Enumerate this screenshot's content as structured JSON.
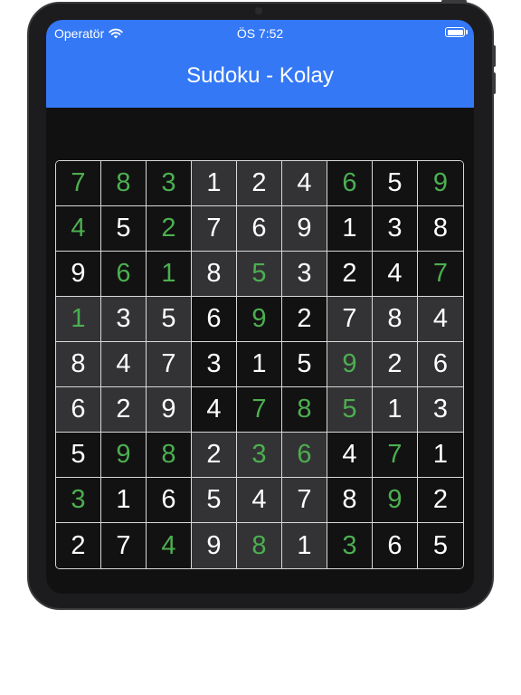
{
  "status_bar": {
    "carrier": "Operatör",
    "time": "ÖS 7:52",
    "wifi_icon": "wifi-icon",
    "battery_icon": "battery-icon"
  },
  "navbar": {
    "title": "Sudoku - Kolay"
  },
  "colors": {
    "accent": "#3478f6",
    "given_digit": "#ffffff",
    "entered_digit": "#4caf50",
    "box_dark": "#121212",
    "box_light": "#333335",
    "grid_line": "#d8d8d8"
  },
  "board": {
    "rows": [
      [
        "7",
        "8",
        "3",
        "1",
        "2",
        "4",
        "6",
        "5",
        "9"
      ],
      [
        "4",
        "5",
        "2",
        "7",
        "6",
        "9",
        "1",
        "3",
        "8"
      ],
      [
        "9",
        "6",
        "1",
        "8",
        "5",
        "3",
        "2",
        "4",
        "7"
      ],
      [
        "1",
        "3",
        "5",
        "6",
        "9",
        "2",
        "7",
        "8",
        "4"
      ],
      [
        "8",
        "4",
        "7",
        "3",
        "1",
        "5",
        "9",
        "2",
        "6"
      ],
      [
        "6",
        "2",
        "9",
        "4",
        "7",
        "8",
        "5",
        "1",
        "3"
      ],
      [
        "5",
        "9",
        "8",
        "2",
        "3",
        "6",
        "4",
        "7",
        "1"
      ],
      [
        "3",
        "1",
        "6",
        "5",
        "4",
        "7",
        "8",
        "9",
        "2"
      ],
      [
        "2",
        "7",
        "4",
        "9",
        "8",
        "1",
        "3",
        "6",
        "5"
      ]
    ],
    "entered": [
      [
        1,
        1,
        1,
        0,
        0,
        0,
        1,
        0,
        1
      ],
      [
        1,
        0,
        1,
        0,
        0,
        0,
        0,
        0,
        0
      ],
      [
        0,
        1,
        1,
        0,
        1,
        0,
        0,
        0,
        1
      ],
      [
        1,
        0,
        0,
        0,
        1,
        0,
        0,
        0,
        0
      ],
      [
        0,
        0,
        0,
        0,
        0,
        0,
        1,
        0,
        0
      ],
      [
        0,
        0,
        0,
        0,
        1,
        1,
        1,
        0,
        0
      ],
      [
        0,
        1,
        1,
        0,
        1,
        1,
        0,
        1,
        0
      ],
      [
        1,
        0,
        0,
        0,
        0,
        0,
        0,
        1,
        0
      ],
      [
        0,
        0,
        1,
        0,
        1,
        0,
        1,
        0,
        0
      ]
    ]
  }
}
